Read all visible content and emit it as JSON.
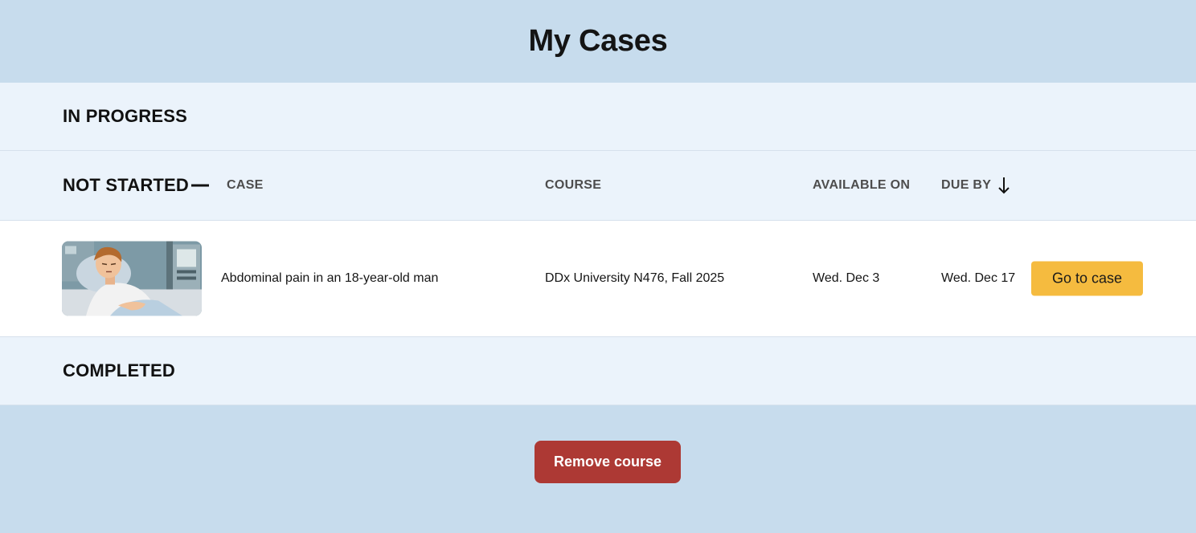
{
  "page": {
    "title": "My Cases"
  },
  "sections": {
    "in_progress": "IN PROGRESS",
    "not_started": "NOT STARTED",
    "completed": "COMPLETED"
  },
  "columns": {
    "case": "CASE",
    "course": "COURSE",
    "available_on": "AVAILABLE ON",
    "due_by": "DUE BY"
  },
  "icons": {
    "collapse": "minus-icon",
    "sort": "arrow-down-icon"
  },
  "cases": [
    {
      "thumbnail": "patient-in-hospital-bed-illustration",
      "title": "Abdominal pain in an 18-year-old man",
      "course": "DDx University N476, Fall 2025",
      "available_on": "Wed. Dec 3",
      "due_by": "Wed. Dec 17",
      "action_label": "Go to case"
    }
  ],
  "footer": {
    "remove_label": "Remove course"
  },
  "colors": {
    "background": "#c7dced",
    "section_bg": "#ebf3fb",
    "primary_action": "#f5bb3f",
    "danger_action": "#ad3934"
  }
}
